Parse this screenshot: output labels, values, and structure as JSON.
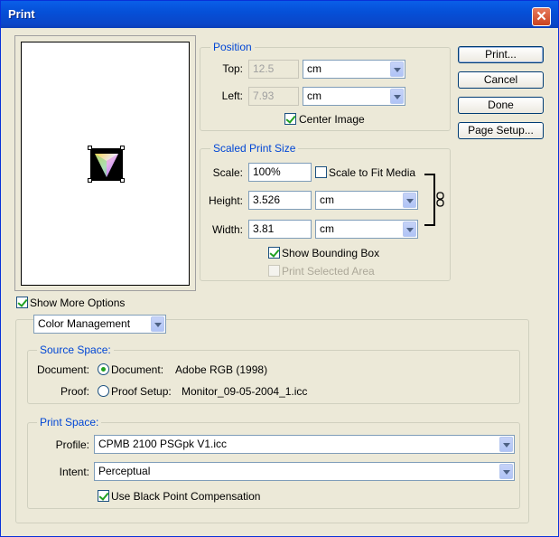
{
  "window": {
    "title": "Print"
  },
  "buttons": {
    "print": "Print...",
    "cancel": "Cancel",
    "done": "Done",
    "page_setup": "Page Setup..."
  },
  "position": {
    "legend": "Position",
    "top_label": "Top:",
    "top_value": "12.5",
    "top_unit": "cm",
    "left_label": "Left:",
    "left_value": "7.93",
    "left_unit": "cm",
    "center_image_label": "Center Image",
    "center_image_checked": true
  },
  "scaled": {
    "legend": "Scaled Print Size",
    "scale_label": "Scale:",
    "scale_value": "100%",
    "scale_to_fit_label": "Scale to Fit Media",
    "scale_to_fit_checked": false,
    "height_label": "Height:",
    "height_value": "3.526",
    "height_unit": "cm",
    "width_label": "Width:",
    "width_value": "3.81",
    "width_unit": "cm",
    "show_bbox_label": "Show Bounding Box",
    "show_bbox_checked": true,
    "print_selected_label": "Print Selected Area",
    "print_selected_enabled": false
  },
  "more_options": {
    "label": "Show More Options",
    "checked": true,
    "mode": "Color Management"
  },
  "source_space": {
    "legend": "Source Space:",
    "document_label": "Document:",
    "document_option": "Document:",
    "document_value": "Adobe RGB (1998)",
    "proof_label": "Proof:",
    "proof_option": "Proof Setup:",
    "proof_value": "Monitor_09-05-2004_1.icc",
    "selected": "document"
  },
  "print_space": {
    "legend": "Print Space:",
    "profile_label": "Profile:",
    "profile_value": "CPMB 2100 PSGpk V1.icc",
    "intent_label": "Intent:",
    "intent_value": "Perceptual",
    "bpc_label": "Use Black Point Compensation",
    "bpc_checked": true
  },
  "colors": {
    "title_bar": "#0a5fe8",
    "group_label": "#0046d5",
    "dialog_bg": "#ece9d8"
  },
  "icons": [
    "close-icon",
    "chain-link-icon",
    "color-triangle-icon",
    "dropdown-arrow-icon"
  ]
}
